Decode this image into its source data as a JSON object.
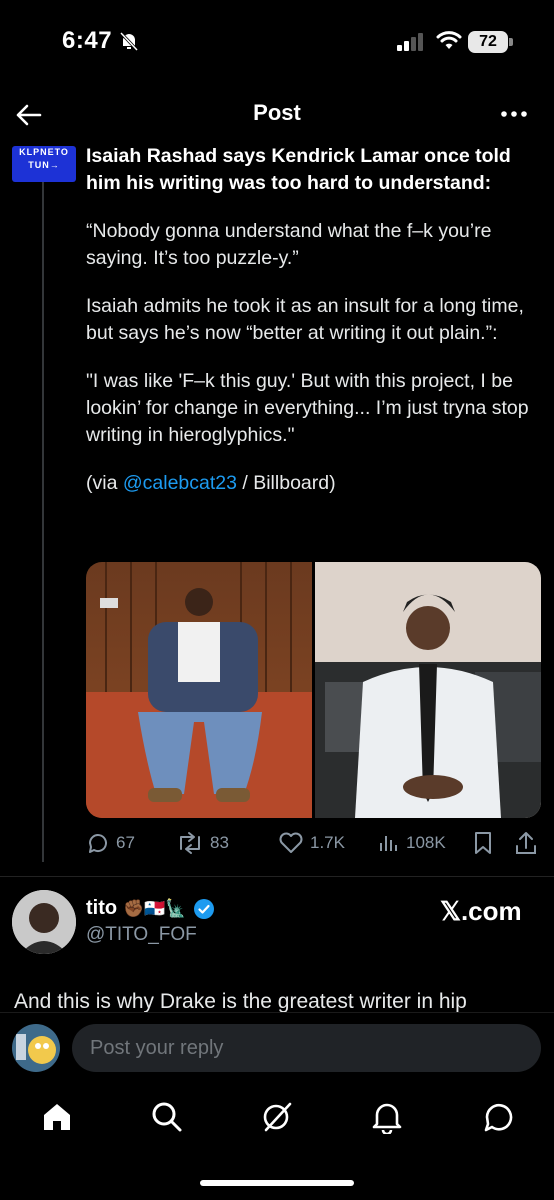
{
  "status_bar": {
    "time": "6:47",
    "battery": "72"
  },
  "header": {
    "title": "Post"
  },
  "post": {
    "headline": "Isaiah Rashad says Kendrick Lamar once told him his writing was too hard to understand:",
    "paragraph_1": "“Nobody gonna understand what the f–k you’re saying. It’s too puzzle-y.”",
    "paragraph_2": "Isaiah admits he took it as an insult for a long time, but says he’s now “better at writing it out plain.”:",
    "paragraph_3": "\"I was like 'F–k this guy.' But with this project, I be lookin’ for change in everything... I’m just tryna stop writing in hieroglyphics.\"",
    "via_prefix": "(via ",
    "via_link": "@calebcat23",
    "via_suffix": " / Billboard)",
    "avatar_text_1": "KLPNETO",
    "avatar_text_2": "TUN→"
  },
  "actions": {
    "replies": "67",
    "reposts": "83",
    "likes": "1.7K",
    "views": "108K"
  },
  "reply_post": {
    "name": "tito",
    "handle": "@TITO_FOF",
    "emojis": "✊🏾🇵🇦🗽",
    "source": "𝕏.com",
    "text": "And this is why Drake is the greatest writer in hip"
  },
  "composer": {
    "placeholder": "Post your reply"
  },
  "colors": {
    "accent": "#1d9bf0",
    "background": "#000000",
    "muted": "#8b98a5"
  },
  "tabs": [
    "home-icon",
    "search-icon",
    "grok-icon",
    "notifications-icon",
    "messages-icon"
  ]
}
